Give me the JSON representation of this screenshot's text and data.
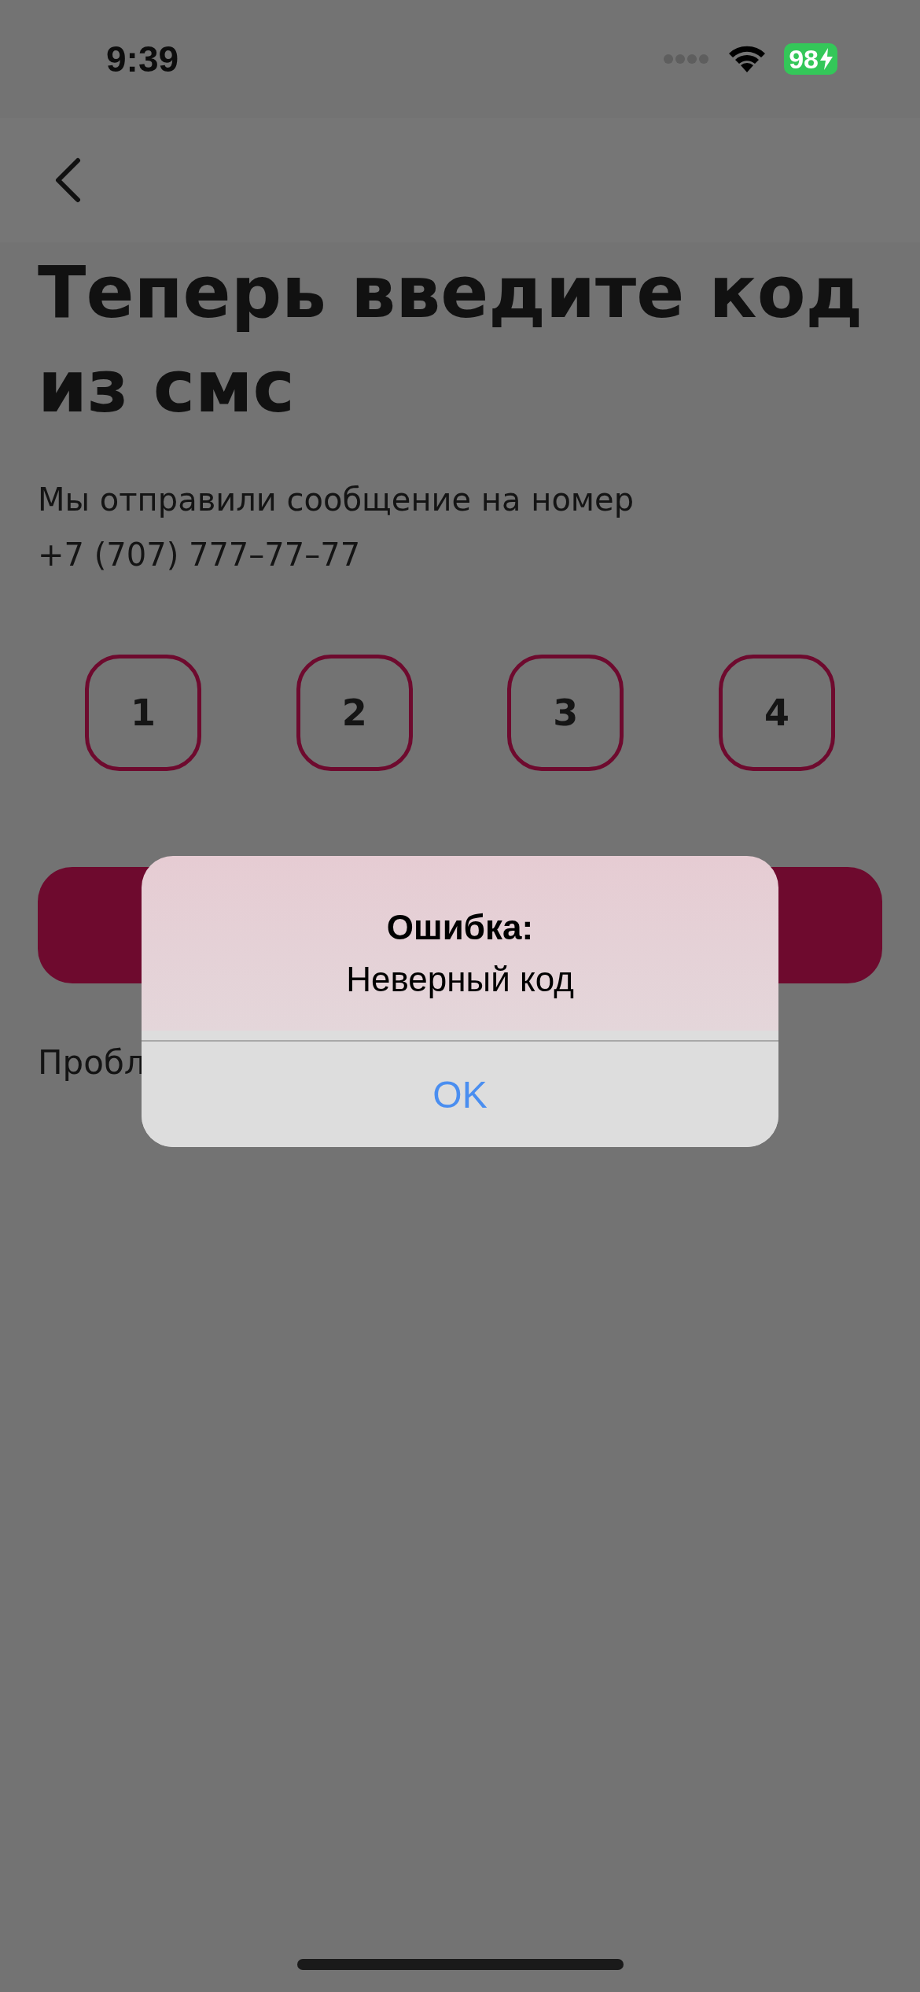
{
  "status_bar": {
    "time": "9:39",
    "battery": "98"
  },
  "title": "Теперь введите код из смс",
  "subtitle_lines": [
    "Мы отправили сообщение на номер",
    "+7 (707) 777–77–77"
  ],
  "code_digits": [
    "1",
    "2",
    "3",
    "4"
  ],
  "help_text": "Пробл",
  "alert": {
    "title": "Ошибка:",
    "message": "Неверный код",
    "button": "OK"
  }
}
